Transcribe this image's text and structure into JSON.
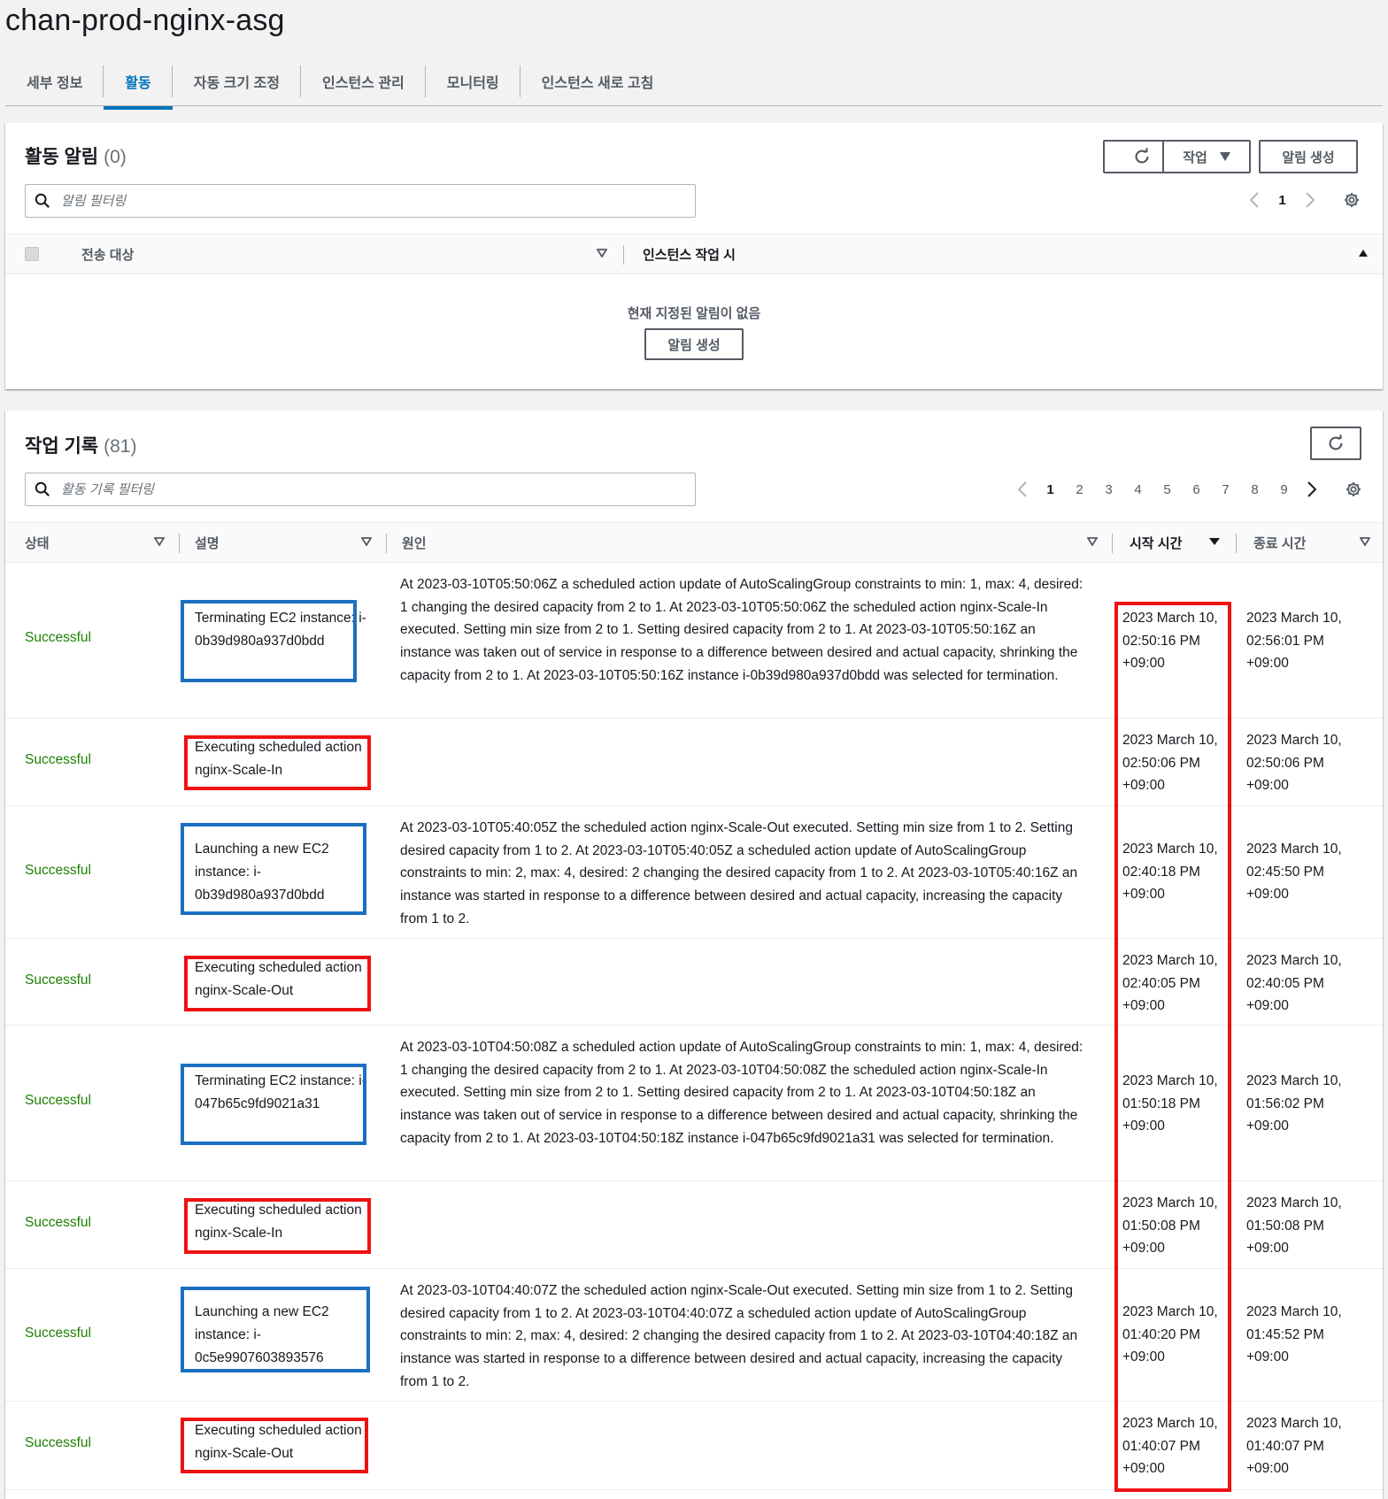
{
  "page": {
    "title": "chan-prod-nginx-asg"
  },
  "tabs": [
    {
      "label": "세부 정보"
    },
    {
      "label": "활동"
    },
    {
      "label": "자동 크기 조정"
    },
    {
      "label": "인스턴스 관리"
    },
    {
      "label": "모니터링"
    },
    {
      "label": "인스턴스 새로 고침"
    }
  ],
  "notifications": {
    "title": "활동 알림",
    "count": "(0)",
    "actions_label": "작업",
    "create_label": "알림 생성",
    "search_placeholder": "알림 필터링",
    "page": "1",
    "columns": [
      "전송 대상",
      "인스턴스 작업 시"
    ],
    "empty_text": "현재 지정된 알림이 없음",
    "empty_button": "알림 생성"
  },
  "history": {
    "title": "작업 기록",
    "count": "(81)",
    "search_placeholder": "활동 기록 필터링",
    "pages": [
      "1",
      "2",
      "3",
      "4",
      "5",
      "6",
      "7",
      "8",
      "9"
    ],
    "current_page": "1",
    "columns": [
      "상태",
      "설명",
      "원인",
      "시작 시간",
      "종료 시간"
    ],
    "rows": [
      {
        "status": "Successful",
        "description": "Terminating EC2 instance: i-0b39d980a937d0bdd",
        "cause": "At 2023-03-10T05:50:06Z a scheduled action update of AutoScalingGroup constraints to min: 1, max: 4, desired: 1 changing the desired capacity from 2 to 1. At 2023-03-10T05:50:06Z the scheduled action nginx-Scale-In executed. Setting min size from 2 to 1. Setting desired capacity from 2 to 1. At 2023-03-10T05:50:16Z an instance was taken out of service in response to a difference between desired and actual capacity, shrinking the capacity from 2 to 1. At 2023-03-10T05:50:16Z instance i-0b39d980a937d0bdd was selected for termination.",
        "start": "2023 March 10, 02:50:16 PM +09:00",
        "end": "2023 March 10, 02:56:01 PM +09:00"
      },
      {
        "status": "Successful",
        "description": "Executing scheduled action nginx-Scale-In",
        "cause": "",
        "start": "2023 March 10, 02:50:06 PM +09:00",
        "end": "2023 March 10, 02:50:06 PM +09:00"
      },
      {
        "status": "Successful",
        "description": "Launching a new EC2 instance: i-0b39d980a937d0bdd",
        "cause": "At 2023-03-10T05:40:05Z the scheduled action nginx-Scale-Out executed. Setting min size from 1 to 2. Setting desired capacity from 1 to 2. At 2023-03-10T05:40:05Z a scheduled action update of AutoScalingGroup constraints to min: 2, max: 4, desired: 2 changing the desired capacity from 1 to 2. At 2023-03-10T05:40:16Z an instance was started in response to a difference between desired and actual capacity, increasing the capacity from 1 to 2.",
        "start": "2023 March 10, 02:40:18 PM +09:00",
        "end": "2023 March 10, 02:45:50 PM +09:00"
      },
      {
        "status": "Successful",
        "description": "Executing scheduled action nginx-Scale-Out",
        "cause": "",
        "start": "2023 March 10, 02:40:05 PM +09:00",
        "end": "2023 March 10, 02:40:05 PM +09:00"
      },
      {
        "status": "Successful",
        "description": "Terminating EC2 instance: i-047b65c9fd9021a31",
        "cause": "At 2023-03-10T04:50:08Z a scheduled action update of AutoScalingGroup constraints to min: 1, max: 4, desired: 1 changing the desired capacity from 2 to 1. At 2023-03-10T04:50:08Z the scheduled action nginx-Scale-In executed. Setting min size from 2 to 1. Setting desired capacity from 2 to 1. At 2023-03-10T04:50:18Z an instance was taken out of service in response to a difference between desired and actual capacity, shrinking the capacity from 2 to 1. At 2023-03-10T04:50:18Z instance i-047b65c9fd9021a31 was selected for termination.",
        "start": "2023 March 10, 01:50:18 PM +09:00",
        "end": "2023 March 10, 01:56:02 PM +09:00"
      },
      {
        "status": "Successful",
        "description": "Executing scheduled action nginx-Scale-In",
        "cause": "",
        "start": "2023 March 10, 01:50:08 PM +09:00",
        "end": "2023 March 10, 01:50:08 PM +09:00"
      },
      {
        "status": "Successful",
        "description": "Launching a new EC2 instance: i-0c5e9907603893576",
        "cause": "At 2023-03-10T04:40:07Z the scheduled action nginx-Scale-Out executed. Setting min size from 1 to 2. Setting desired capacity from 1 to 2. At 2023-03-10T04:40:07Z a scheduled action update of AutoScalingGroup constraints to min: 2, max: 4, desired: 2 changing the desired capacity from 1 to 2. At 2023-03-10T04:40:18Z an instance was started in response to a difference between desired and actual capacity, increasing the capacity from 1 to 2.",
        "start": "2023 March 10, 01:40:20 PM +09:00",
        "end": "2023 March 10, 01:45:52 PM +09:00"
      },
      {
        "status": "Successful",
        "description": "Executing scheduled action nginx-Scale-Out",
        "cause": "",
        "start": "2023 March 10, 01:40:07 PM +09:00",
        "end": "2023 March 10, 01:40:07 PM +09:00"
      }
    ]
  },
  "colors": {
    "accent": "#0073bb",
    "success": "#1d8102",
    "highlight_blue": "#1b6fc1",
    "highlight_red": "#ee1111"
  },
  "icons": [
    "refresh-icon",
    "caret-down-icon",
    "search-icon",
    "chevron-left-icon",
    "chevron-right-icon",
    "gear-icon",
    "sort-down-icon",
    "sort-up-icon"
  ]
}
